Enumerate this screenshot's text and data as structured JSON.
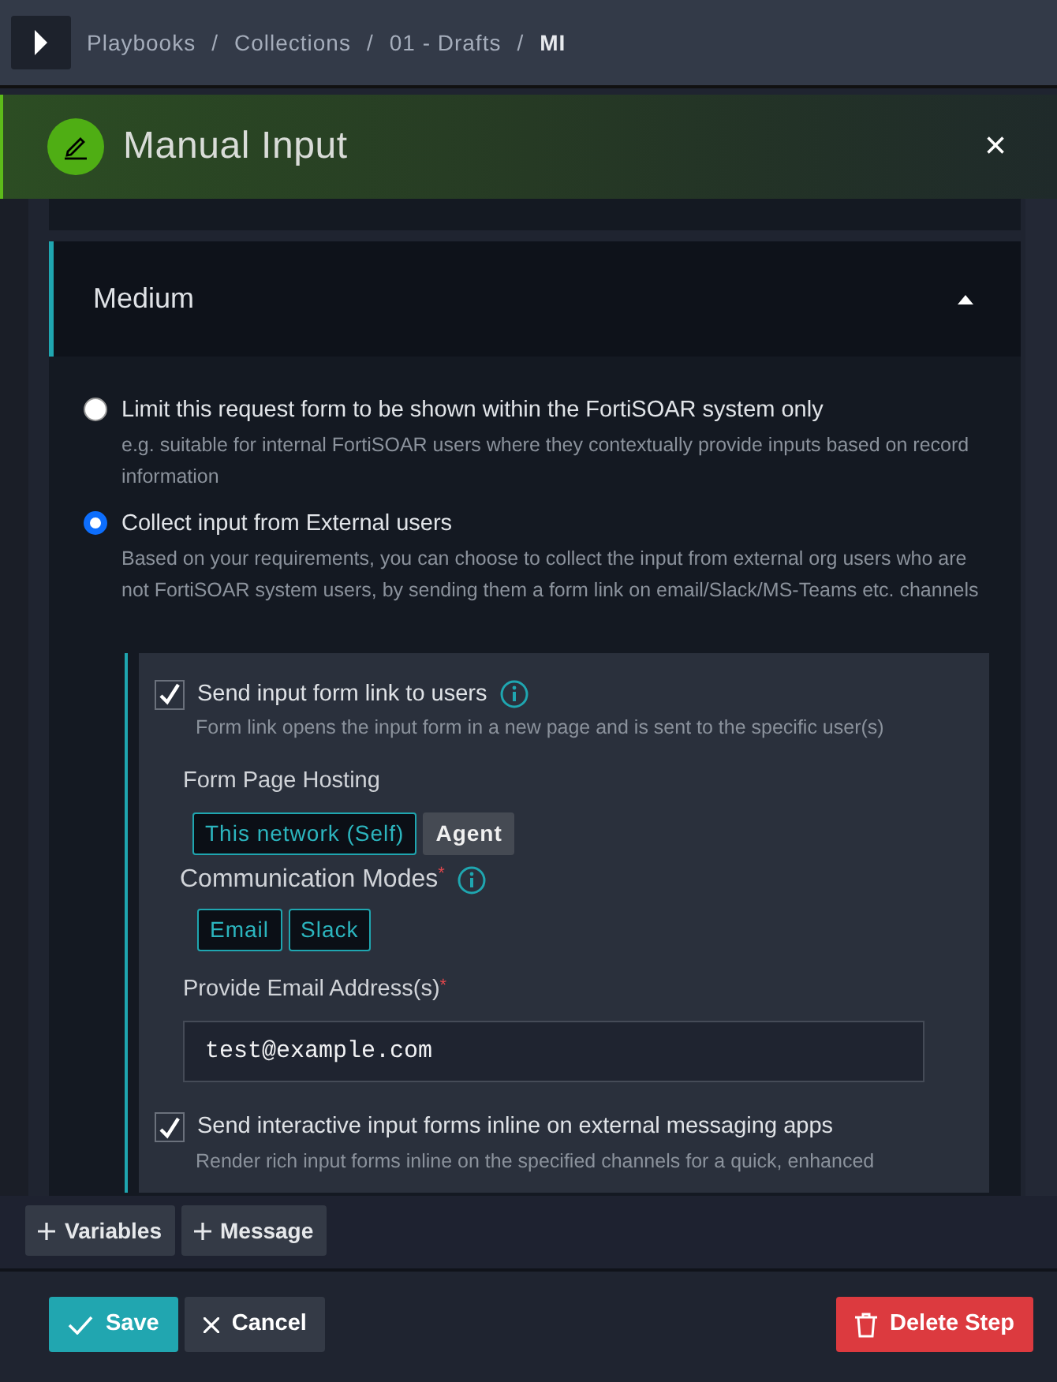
{
  "breadcrumb": [
    {
      "label": "Playbooks",
      "current": false
    },
    {
      "label": "Collections",
      "current": false
    },
    {
      "label": "01 - Drafts",
      "current": false
    },
    {
      "label": "MI",
      "current": true
    }
  ],
  "separator": "/",
  "dialog": {
    "title": "Manual Input",
    "close": "×"
  },
  "section": {
    "title": "Medium",
    "expanded": true
  },
  "options": [
    {
      "label": "Limit this request form to be shown within the FortiSOAR system only",
      "hint": "e.g. suitable for internal FortiSOAR users where they contextually provide inputs based on record information",
      "selected": false
    },
    {
      "label": "Collect input from External users",
      "hint": "Based on your requirements, you can choose to collect the input from external org users who are not FortiSOAR system users, by sending them a form link on email/Slack/MS-Teams etc. channels",
      "selected": true
    }
  ],
  "send_link": {
    "label": "Send input form link to users",
    "checked": true,
    "hint": "Form link opens the input form in a new page and is sent to the specific user(s)"
  },
  "hosting": {
    "label": "Form Page Hosting",
    "choices": [
      {
        "label": "This network (Self)",
        "selected": true
      },
      {
        "label": "Agent",
        "selected": false
      }
    ]
  },
  "required_mark": "*",
  "modes": {
    "label": "Communication Modes",
    "required": true,
    "choices": [
      {
        "label": "Email",
        "selected": true
      },
      {
        "label": "Slack",
        "selected": true
      }
    ]
  },
  "email": {
    "label": "Provide Email Address(s)",
    "required": true,
    "value": "test@example.com"
  },
  "inline_forms": {
    "label": "Send interactive input forms inline on external messaging apps",
    "checked": true,
    "hint": "Render rich input forms inline on the specified channels for a quick, enhanced"
  },
  "toolbar": [
    "Variables",
    "Message"
  ],
  "footer": {
    "save": "Save",
    "cancel": "Cancel",
    "delete": "Delete Step"
  }
}
